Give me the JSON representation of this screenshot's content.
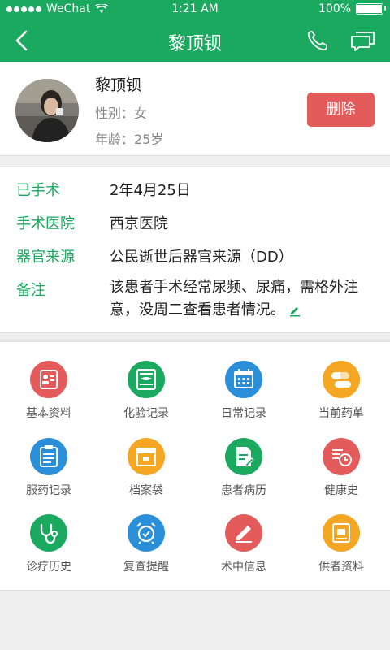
{
  "statusbar": {
    "carrier": "WeChat",
    "time": "1:21 AM",
    "battery": "100%"
  },
  "navbar": {
    "title": "黎顶钡"
  },
  "patient": {
    "name": "黎顶钡",
    "gender": "性别：女",
    "age": "年龄：25岁",
    "delete_label": "删除"
  },
  "info": {
    "surgery_label": "已手术",
    "surgery_value": "2年4月25日",
    "hospital_label": "手术医院",
    "hospital_value": "西京医院",
    "organ_label": "器官来源",
    "organ_value": "公民逝世后器官来源（DD）",
    "note_label": "备注",
    "note_value": "该患者手术经常尿频、尿痛，需格外注意，没周二查看患者情况。"
  },
  "menu": {
    "items": [
      {
        "label": "基本资料",
        "icon": "profile-card-icon",
        "color": "#e35b5b"
      },
      {
        "label": "化验记录",
        "icon": "lab-record-icon",
        "color": "#1aa95f"
      },
      {
        "label": "日常记录",
        "icon": "calendar-icon",
        "color": "#2a8fd8"
      },
      {
        "label": "当前药单",
        "icon": "pill-icon",
        "color": "#f5a623"
      },
      {
        "label": "服药记录",
        "icon": "medication-log-icon",
        "color": "#2a8fd8"
      },
      {
        "label": "档案袋",
        "icon": "archive-icon",
        "color": "#f5a623"
      },
      {
        "label": "患者病历",
        "icon": "medical-record-icon",
        "color": "#1aa95f"
      },
      {
        "label": "健康史",
        "icon": "health-history-icon",
        "color": "#e35b5b"
      },
      {
        "label": "诊疗历史",
        "icon": "stethoscope-icon",
        "color": "#1aa95f"
      },
      {
        "label": "复查提醒",
        "icon": "alarm-clock-icon",
        "color": "#2a8fd8"
      },
      {
        "label": "术中信息",
        "icon": "pen-icon",
        "color": "#e35b5b"
      },
      {
        "label": "供者资料",
        "icon": "donor-icon",
        "color": "#f5a623"
      }
    ]
  }
}
